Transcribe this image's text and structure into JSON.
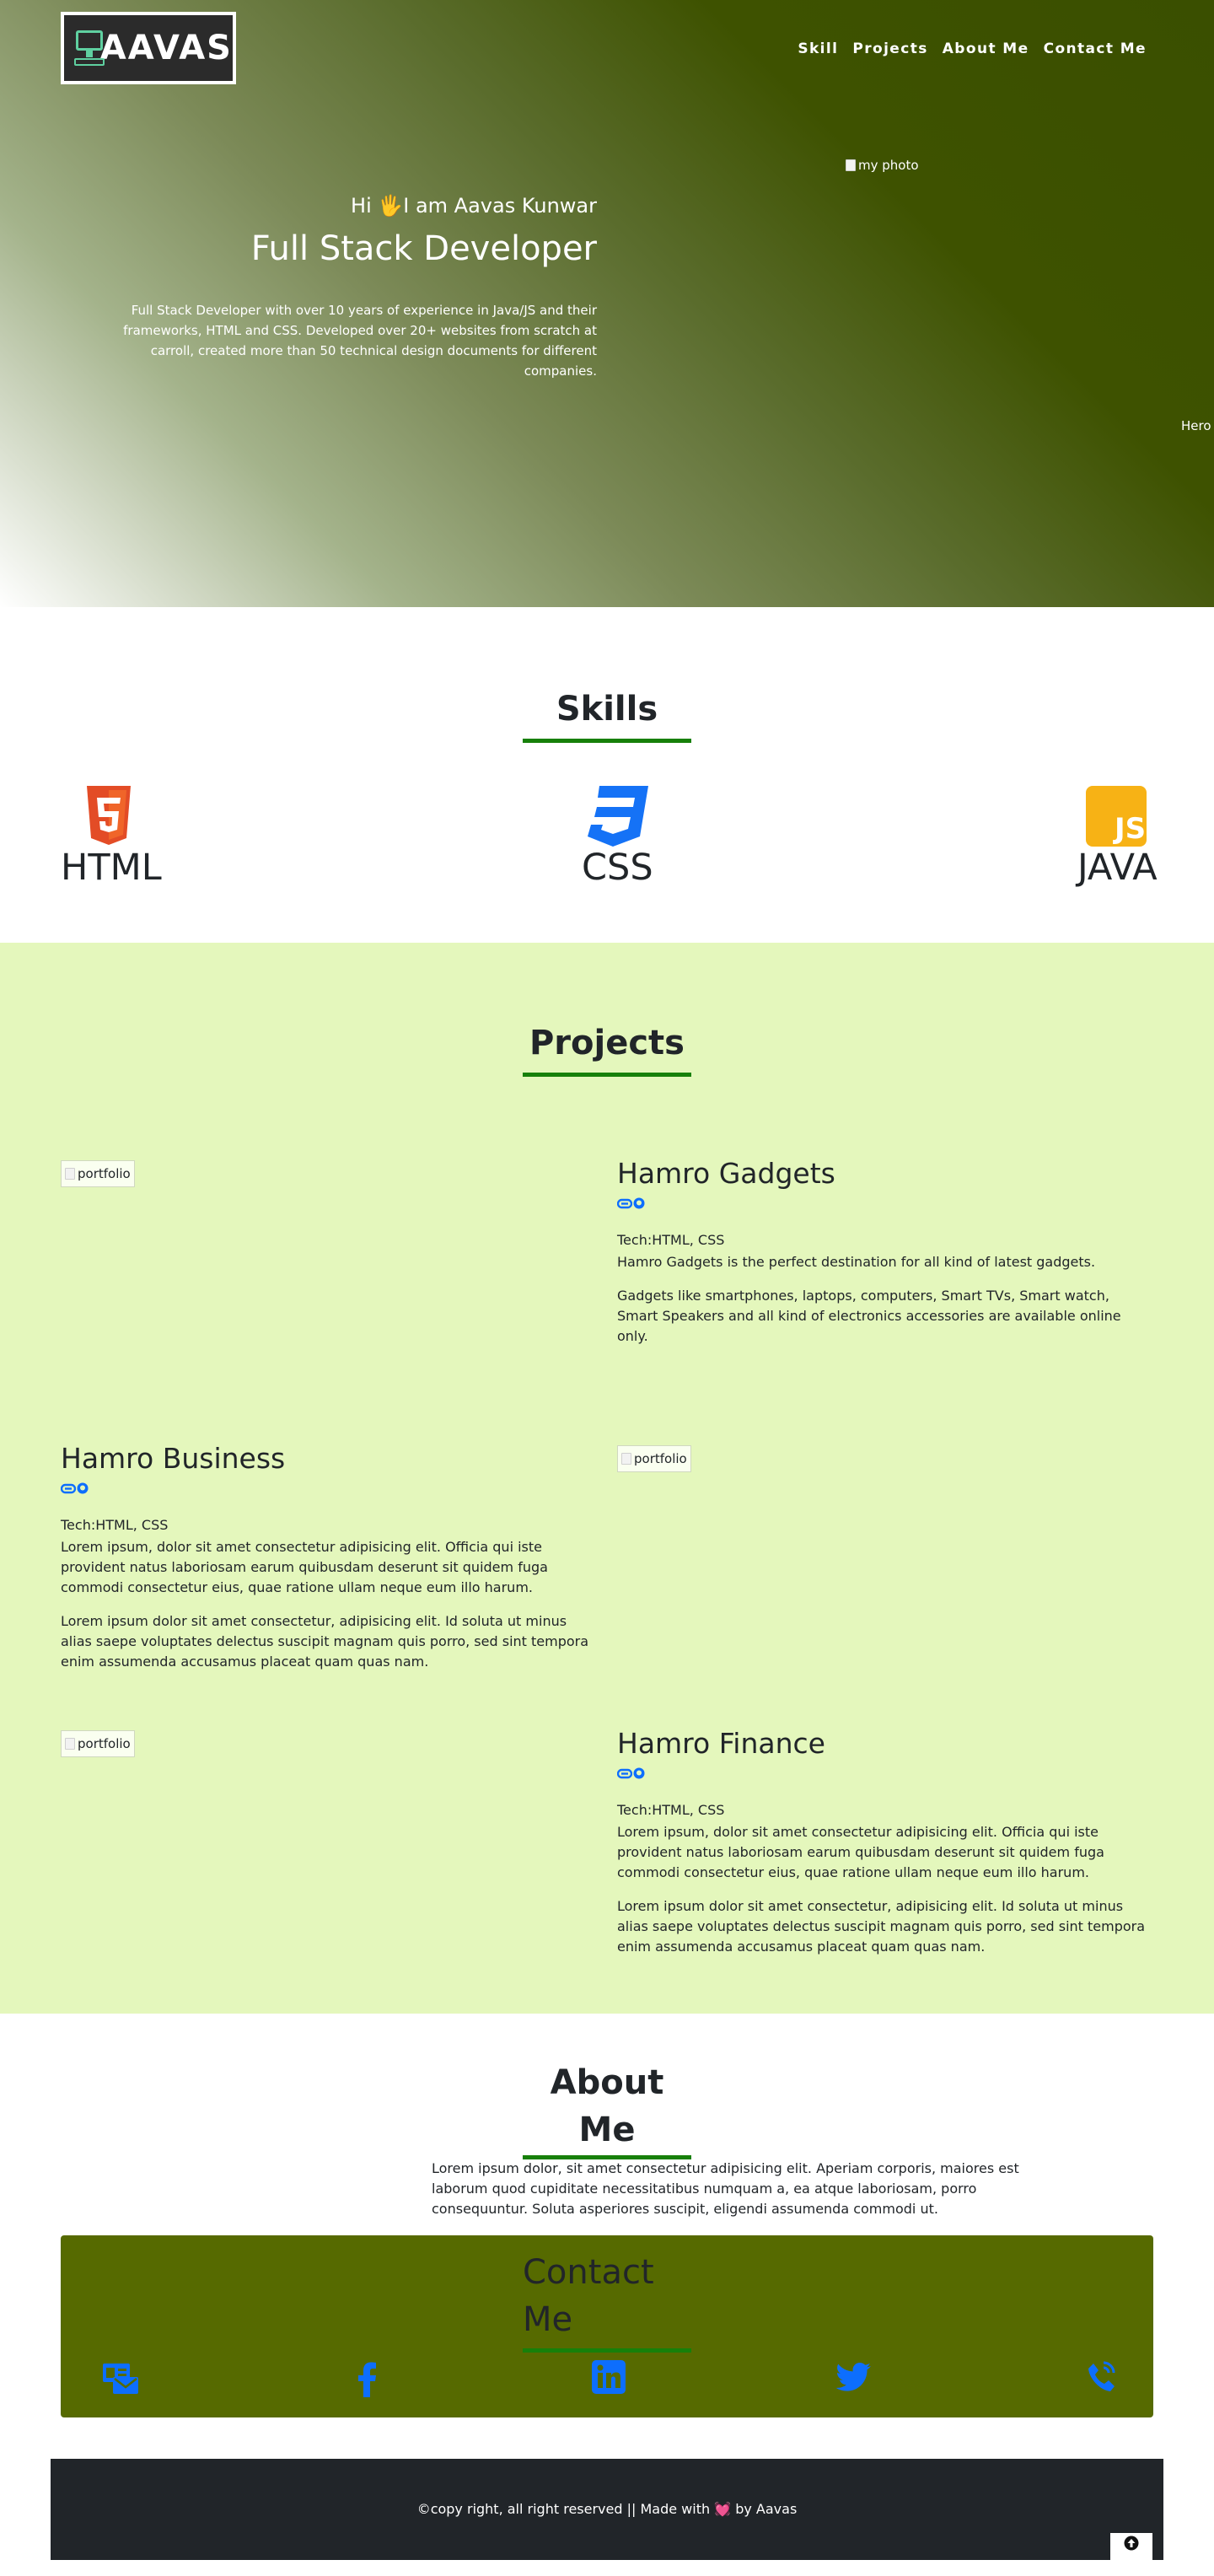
{
  "hero": {
    "logo_text": "AAVAS",
    "nav": [
      "Skill",
      "Projects",
      "About Me",
      "Contact Me"
    ],
    "greeting": "Hi 🖐I am Aavas Kunwar",
    "role": "Full Stack Developer",
    "description": "Full Stack Developer with over 10 years of experience in Java/JS and their frameworks, HTML and CSS. Developed over 20+ websites from scratch at carroll, created more than 50 technical design documents for different companies.",
    "photo_alt": "my photo",
    "hero_alt": "Hero"
  },
  "skills": {
    "title": "Skills",
    "items": [
      {
        "name": "HTML",
        "icon": "html5-icon",
        "color": "#e34c26"
      },
      {
        "name": "CSS",
        "icon": "css3-icon",
        "color": "#1572f6"
      },
      {
        "name": "JAVA",
        "icon": "js-icon",
        "color": "#f7b215"
      }
    ]
  },
  "projects": {
    "title": "Projects",
    "image_alt": "portfolio",
    "items": [
      {
        "title": "Hamro Gadgets",
        "tech": "Tech:HTML, CSS",
        "paragraphs": [
          "Hamro Gadgets is the perfect destination for all kind of latest gadgets.",
          "Gadgets like smartphones, laptops, computers, Smart TVs, Smart watch, Smart Speakers and all kind of electronics accessories are available online only."
        ]
      },
      {
        "title": "Hamro Business",
        "tech": "Tech:HTML, CSS",
        "paragraphs": [
          "Lorem ipsum, dolor sit amet consectetur adipisicing elit. Officia qui iste provident natus laboriosam earum quibusdam deserunt sit quidem fuga commodi consectetur eius, quae ratione ullam neque eum illo harum.",
          "Lorem ipsum dolor sit amet consectetur, adipisicing elit. Id soluta ut minus alias saepe voluptates delectus suscipit magnam quis porro, sed sint tempora enim assumenda accusamus placeat quam quas nam."
        ]
      },
      {
        "title": "Hamro Finance",
        "tech": "Tech:HTML, CSS",
        "paragraphs": [
          "Lorem ipsum, dolor sit amet consectetur adipisicing elit. Officia qui iste provident natus laboriosam earum quibusdam deserunt sit quidem fuga commodi consectetur eius, quae ratione ullam neque eum illo harum.",
          "Lorem ipsum dolor sit amet consectetur, adipisicing elit. Id soluta ut minus alias saepe voluptates delectus suscipit magnam quis porro, sed sint tempora enim assumenda accusamus placeat quam quas nam."
        ]
      }
    ]
  },
  "about": {
    "title": "About Me",
    "text": "Lorem ipsum dolor, sit amet consectetur adipisicing elit. Aperiam corporis, maiores est laborum quod cupiditate necessitatibus numquam a, ea atque laboriosam, porro consequuntur. Soluta asperiores suscipit, eligendi assumenda commodi ut."
  },
  "contact": {
    "title": "Contact Me",
    "icons": [
      "contact-card-icon",
      "facebook-icon",
      "linkedin-icon",
      "twitter-icon",
      "phone-icon"
    ],
    "icon_color": "#0d6efd"
  },
  "footer": {
    "text_before": "©copy right, all right reserved || Made with",
    "heart": "💓",
    "text_after": "by Aavas"
  },
  "colors": {
    "accent_line": "#17800a",
    "hero_dark": "#3a4f00",
    "projects_bg": "#e4f7bc",
    "contact_bg": "#566a00",
    "footer_bg": "#212529",
    "link_blue": "#0d6efd"
  }
}
